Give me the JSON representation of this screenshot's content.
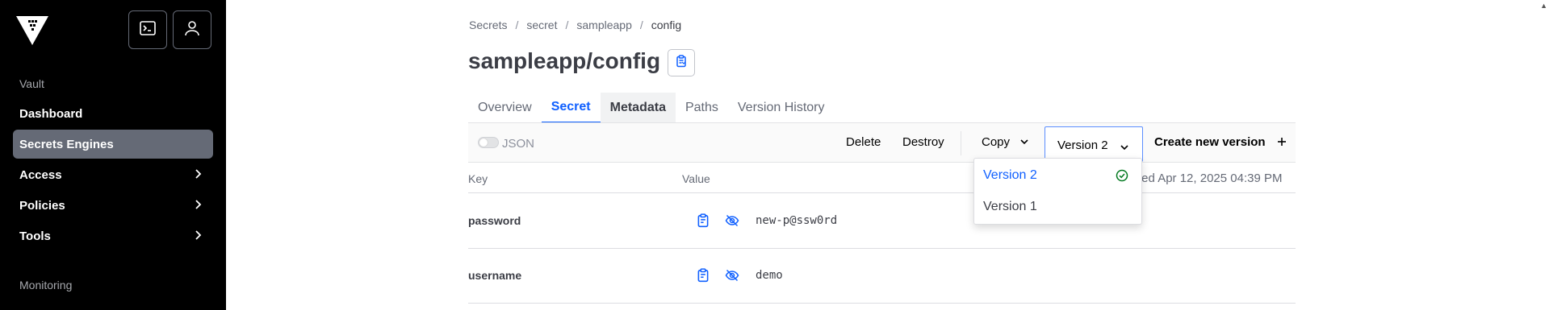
{
  "sidebar": {
    "section_vault": "Vault",
    "items": [
      {
        "label": "Dashboard"
      },
      {
        "label": "Secrets Engines"
      },
      {
        "label": "Access"
      },
      {
        "label": "Policies"
      },
      {
        "label": "Tools"
      }
    ],
    "section_monitoring": "Monitoring"
  },
  "breadcrumb": [
    "Secrets",
    "secret",
    "sampleapp",
    "config"
  ],
  "page": {
    "title": "sampleapp/config"
  },
  "tabs": [
    "Overview",
    "Secret",
    "Metadata",
    "Paths",
    "Version History"
  ],
  "toolbar": {
    "json_label": "JSON",
    "delete_label": "Delete",
    "destroy_label": "Destroy",
    "copy_label": "Copy",
    "version_label": "Version 2",
    "create_label": "Create new version",
    "create_icon": "plus-icon"
  },
  "table": {
    "headers": {
      "key": "Key",
      "value": "Value"
    },
    "updated_text": "ted Apr 12, 2025 04:39 PM",
    "rows": [
      {
        "key": "password",
        "value": "new-p@ssw0rd"
      },
      {
        "key": "username",
        "value": "demo"
      }
    ]
  },
  "dropdown": {
    "options": [
      {
        "label": "Version 2",
        "selected": true
      },
      {
        "label": "Version 1",
        "selected": false
      }
    ]
  },
  "colors": {
    "accent": "#1060ff",
    "sidebar_bg": "#000000",
    "check": "#00781e"
  }
}
